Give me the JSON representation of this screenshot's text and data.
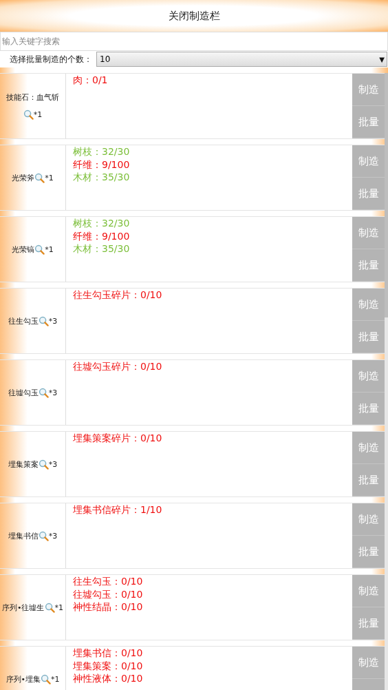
{
  "header": {
    "title": "关闭制造栏"
  },
  "search": {
    "placeholder": "输入关键字搜索"
  },
  "batch": {
    "label": "选择批量制造的个数：",
    "value": "10",
    "caret": "▼"
  },
  "recipes": [
    {
      "name": "技能石：血气斩",
      "count": "*1",
      "materials": [
        {
          "text": "肉：0/1",
          "met": false
        }
      ],
      "buttons": [
        "制造",
        "批量"
      ]
    },
    {
      "name": "光荣斧",
      "count": "*1",
      "materials": [
        {
          "text": "树枝：32/30",
          "met": true
        },
        {
          "text": "纤维：9/100",
          "met": false
        },
        {
          "text": "木材：35/30",
          "met": true
        }
      ],
      "buttons": [
        "制造",
        "批量"
      ]
    },
    {
      "name": "光荣镐",
      "count": "*1",
      "materials": [
        {
          "text": "树枝：32/30",
          "met": true
        },
        {
          "text": "纤维：9/100",
          "met": false
        },
        {
          "text": "木材：35/30",
          "met": true
        }
      ],
      "buttons": [
        "制造",
        "批量"
      ]
    },
    {
      "name": "往生勾玉",
      "count": "*3",
      "materials": [
        {
          "text": "往生勾玉碎片：0/10",
          "met": false
        }
      ],
      "buttons": [
        "制造",
        "批量"
      ]
    },
    {
      "name": "往墟勾玉",
      "count": "*3",
      "materials": [
        {
          "text": "往墟勾玉碎片：0/10",
          "met": false
        }
      ],
      "buttons": [
        "制造",
        "批量"
      ]
    },
    {
      "name": "埋集策案",
      "count": "*3",
      "materials": [
        {
          "text": "埋集策案碎片：0/10",
          "met": false
        }
      ],
      "buttons": [
        "制造",
        "批量"
      ]
    },
    {
      "name": "埋集书信",
      "count": "*3",
      "materials": [
        {
          "text": "埋集书信碎片：1/10",
          "met": false
        }
      ],
      "buttons": [
        "制造",
        "批量"
      ]
    },
    {
      "name": "序列•往墟生",
      "count": "*1",
      "materials": [
        {
          "text": "往生勾玉：0/10",
          "met": false
        },
        {
          "text": "往墟勾玉：0/10",
          "met": false
        },
        {
          "text": "神性结晶：0/10",
          "met": false
        }
      ],
      "buttons": [
        "制造",
        "批量"
      ]
    },
    {
      "name": "序列•埋集",
      "count": "*1",
      "materials": [
        {
          "text": "埋集书信：0/10",
          "met": false
        },
        {
          "text": "埋集策案：0/10",
          "met": false
        },
        {
          "text": "神性液体：0/10",
          "met": false
        }
      ],
      "buttons": [
        "制造"
      ]
    }
  ]
}
